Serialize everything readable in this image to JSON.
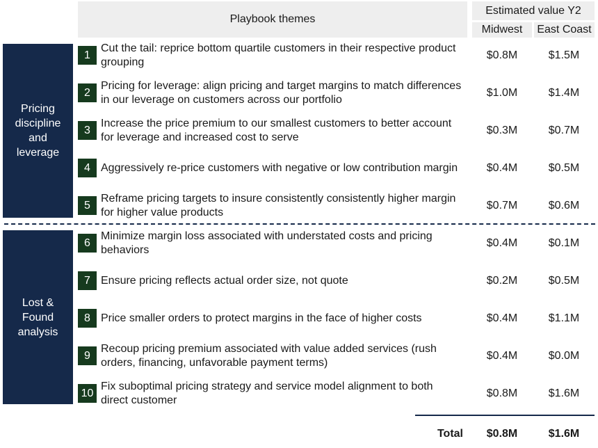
{
  "header": {
    "themes_label": "Playbook themes",
    "estimated_label": "Estimated value Y2",
    "col_midwest": "Midwest",
    "col_east": "East Coast"
  },
  "groups": [
    {
      "label": "Pricing discipline and leverage"
    },
    {
      "label": "Lost & Found analysis"
    }
  ],
  "rows": [
    {
      "num": "1",
      "text": "Cut the tail: reprice bottom quartile customers in their respective product grouping",
      "midwest": "$0.8M",
      "east": "$1.5M"
    },
    {
      "num": "2",
      "text": "Pricing for leverage: align pricing and target margins to match differences in our leverage on customers across our portfolio",
      "midwest": "$1.0M",
      "east": "$1.4M"
    },
    {
      "num": "3",
      "text": "Increase the price premium to our smallest customers to better account for leverage and increased cost to serve",
      "midwest": "$0.3M",
      "east": "$0.7M"
    },
    {
      "num": "4",
      "text": "Aggressively re-price customers with negative or low contribution margin",
      "midwest": "$0.4M",
      "east": "$0.5M"
    },
    {
      "num": "5",
      "text": "Reframe pricing targets to insure consistently consistently higher margin for higher value products",
      "midwest": "$0.7M",
      "east": "$0.6M"
    },
    {
      "num": "6",
      "text": "Minimize margin loss associated with understated costs and pricing behaviors",
      "midwest": "$0.4M",
      "east": "$0.1M"
    },
    {
      "num": "7",
      "text": "Ensure pricing reflects actual order size, not quote",
      "midwest": "$0.2M",
      "east": "$0.5M"
    },
    {
      "num": "8",
      "text": "Price smaller orders to protect margins in the face of higher costs",
      "midwest": "$0.4M",
      "east": "$1.1M"
    },
    {
      "num": "9",
      "text": "Recoup pricing premium associated with value added services (rush orders, financing, unfavorable payment terms)",
      "midwest": "$0.4M",
      "east": "$0.0M"
    },
    {
      "num": "10",
      "text": "Fix suboptimal pricing strategy and service model alignment to both direct customer",
      "midwest": "$0.8M",
      "east": "$1.6M"
    }
  ],
  "total": {
    "label": "Total",
    "midwest": "$0.8M",
    "east": "$1.6M"
  }
}
